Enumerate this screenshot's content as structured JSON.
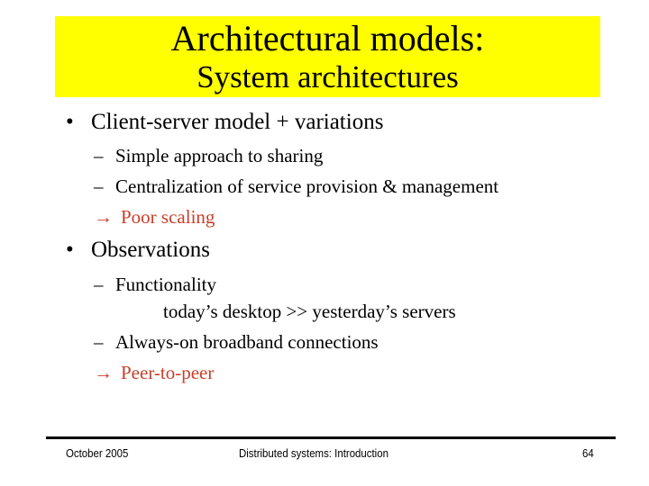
{
  "slide": {
    "title_line1": "Architectural models:",
    "title_line2": "System architectures",
    "title_bg_color": "#ffff00",
    "accent_color": "#c8402a",
    "sections": [
      {
        "bullet": "•",
        "heading": "Client-server model + variations",
        "items": [
          {
            "marker": "–",
            "text": "Simple approach to sharing"
          },
          {
            "marker": "–",
            "text": "Centralization of service provision & management"
          },
          {
            "marker": "→",
            "text": "Poor scaling",
            "highlight": true
          }
        ]
      },
      {
        "bullet": "•",
        "heading": "Observations",
        "items": [
          {
            "marker": "–",
            "text": "Functionality",
            "continuation": "today’s desktop >> yesterday’s servers"
          },
          {
            "marker": "–",
            "text": "Always-on broadband connections"
          },
          {
            "marker": "→",
            "text": "Peer-to-peer",
            "highlight": true
          }
        ]
      }
    ]
  },
  "footer": {
    "date": "October 2005",
    "course": "Distributed systems: Introduction",
    "page_number": "64"
  }
}
